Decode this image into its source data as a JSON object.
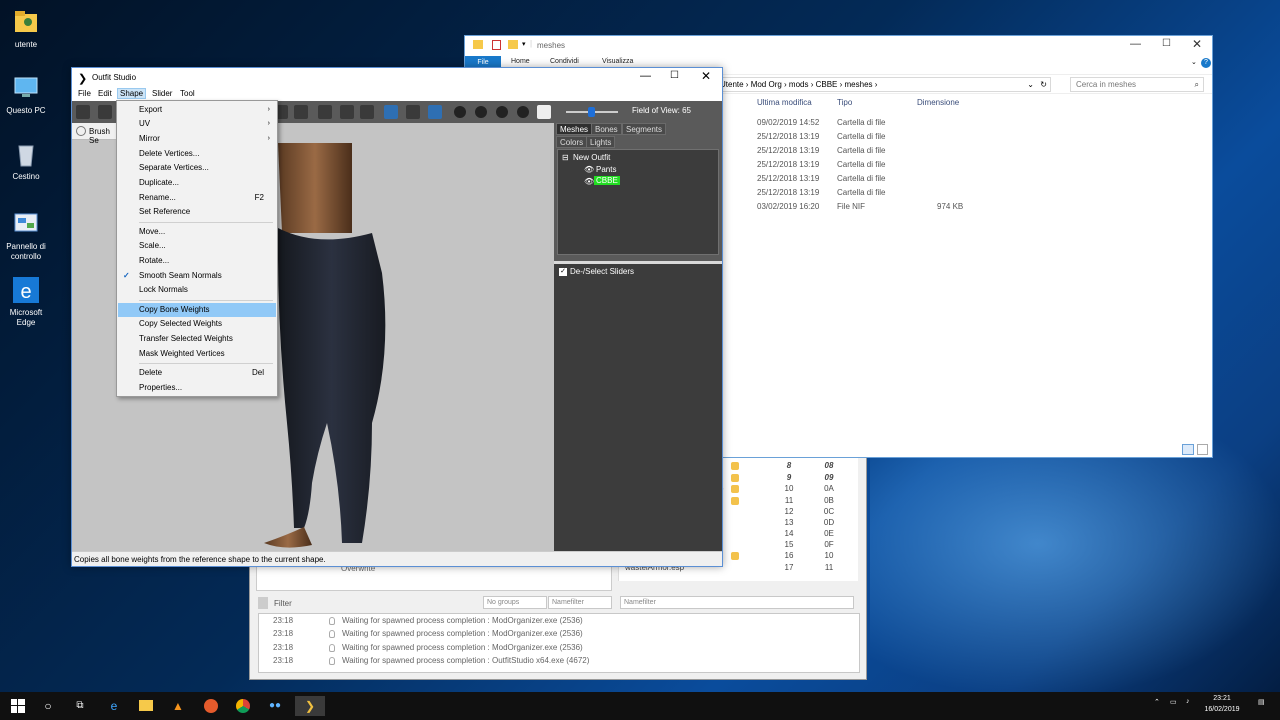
{
  "desktop": {
    "icons": [
      {
        "label": "utente",
        "icon": "user-folder-icon"
      },
      {
        "label": "Questo PC",
        "icon": "computer-icon"
      },
      {
        "label": "Cestino",
        "icon": "recycle-bin-icon"
      },
      {
        "label": "Pannello di controllo",
        "icon": "control-panel-icon"
      },
      {
        "label": "Microsoft Edge",
        "icon": "edge-icon"
      }
    ]
  },
  "explorer": {
    "title": "meshes",
    "ribbon": {
      "file": "File",
      "home": "Home",
      "share": "Condividi",
      "view": "Visualizza"
    },
    "address": [
      "Utente",
      "Mod Org",
      "mods",
      "CBBE",
      "meshes"
    ],
    "search_placeholder": "Cerca in meshes",
    "columns": {
      "modified": "Ultima modifica",
      "type": "Tipo",
      "size": "Dimensione"
    },
    "rows": [
      {
        "modified": "09/02/2019 14:52",
        "type": "Cartella di file",
        "size": ""
      },
      {
        "modified": "25/12/2018 13:19",
        "type": "Cartella di file",
        "size": ""
      },
      {
        "modified": "25/12/2018 13:19",
        "type": "Cartella di file",
        "size": ""
      },
      {
        "modified": "25/12/2018 13:19",
        "type": "Cartella di file",
        "size": ""
      },
      {
        "modified": "25/12/2018 13:19",
        "type": "Cartella di file",
        "size": ""
      },
      {
        "modified": "25/12/2018 13:19",
        "type": "Cartella di file",
        "size": ""
      },
      {
        "modified": "03/02/2019 16:20",
        "type": "File NIF",
        "size": "974 KB"
      }
    ]
  },
  "mo2": {
    "plugins": [
      {
        "a": "8",
        "b": "08",
        "bold": true
      },
      {
        "a": "9",
        "b": "09",
        "bold": true
      },
      {
        "a": "10",
        "b": "0A"
      },
      {
        "a": "11",
        "b": "0B"
      },
      {
        "a": "12",
        "b": "0C"
      },
      {
        "a": "13",
        "b": "0D"
      },
      {
        "a": "14",
        "b": "0E"
      },
      {
        "a": "15",
        "b": "0F"
      },
      {
        "a": "16",
        "b": "10"
      },
      {
        "a": "17",
        "b": "11"
      }
    ],
    "plugin_names": [
      "wastelArmor.esp"
    ],
    "overwrite_label": "Overwrite",
    "filter_label": "Filter",
    "groups_select": "No groups",
    "namefilter_placeholder": "Namefilter",
    "namefilter2_placeholder": "Namefilter",
    "log": [
      {
        "time": "23:18",
        "msg": "Waiting for spawned process completion : ModOrganizer.exe (2536)"
      },
      {
        "time": "23:18",
        "msg": "Waiting for spawned process completion : ModOrganizer.exe (2536)"
      },
      {
        "time": "23:18",
        "msg": "Waiting for spawned process completion : ModOrganizer.exe (2536)"
      },
      {
        "time": "23:18",
        "msg": "Waiting for spawned process completion : OutfitStudio x64.exe (4672)"
      }
    ]
  },
  "outfit_studio": {
    "title": "Outfit Studio",
    "menu": [
      "File",
      "Edit",
      "Shape",
      "Slider",
      "Tool"
    ],
    "brush_label": "Brush Se",
    "fov_label": "Field of View: 65",
    "tabs": [
      "Meshes",
      "Bones",
      "Segments",
      "Colors",
      "Lights"
    ],
    "tree": {
      "root": "New Outfit",
      "children": [
        "Pants",
        "CBBE"
      ]
    },
    "slider_header": "De-/Select Sliders",
    "status": "Copies all bone weights from the reference shape to the current shape."
  },
  "shape_menu": {
    "items": [
      {
        "label": "Export",
        "submenu": true
      },
      {
        "label": "UV",
        "submenu": true
      },
      {
        "label": "Mirror",
        "submenu": true
      },
      {
        "label": "Delete Vertices..."
      },
      {
        "label": "Separate Vertices..."
      },
      {
        "label": "Duplicate..."
      },
      {
        "label": "Rename...",
        "shortcut": "F2"
      },
      {
        "label": "Set Reference"
      },
      {
        "label": "Move..."
      },
      {
        "label": "Scale..."
      },
      {
        "label": "Rotate..."
      },
      {
        "label": "Smooth Seam Normals",
        "checked": true
      },
      {
        "label": "Lock Normals"
      },
      {
        "label": "Copy Bone Weights",
        "highlighted": true
      },
      {
        "label": "Copy Selected Weights"
      },
      {
        "label": "Transfer Selected Weights"
      },
      {
        "label": "Mask Weighted Vertices"
      },
      {
        "label": "Delete",
        "shortcut": "Del"
      },
      {
        "label": "Properties..."
      }
    ]
  },
  "taskbar": {
    "clock_time": "23:21",
    "clock_date": "16/02/2019"
  },
  "colors": {
    "accent": "#1979ca",
    "menu_highlight": "#91c9f7",
    "mesh_selected": "#22dd22"
  }
}
